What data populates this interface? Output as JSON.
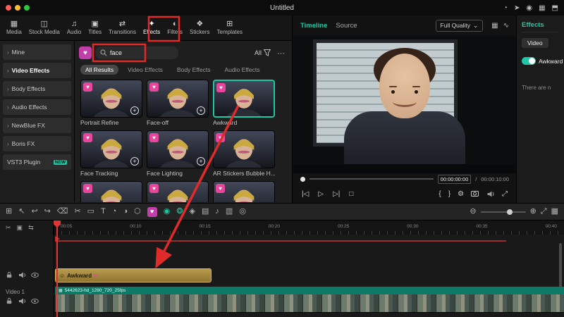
{
  "colors": {
    "accent_teal": "#1ec8a5",
    "accent_pink": "#e8459c",
    "annotation_red": "#e02b2b",
    "clip_gold": "#a98937"
  },
  "titlebar": {
    "title": "Untitled"
  },
  "media_tabs": [
    {
      "label": "Media"
    },
    {
      "label": "Stock Media"
    },
    {
      "label": "Audio"
    },
    {
      "label": "Titles"
    },
    {
      "label": "Transitions"
    },
    {
      "label": "Effects"
    },
    {
      "label": "Filters"
    },
    {
      "label": "Stickers"
    },
    {
      "label": "Templates"
    }
  ],
  "sidebar": {
    "items": [
      {
        "label": "Mine"
      },
      {
        "label": "Video Effects"
      },
      {
        "label": "Body Effects"
      },
      {
        "label": "Audio Effects"
      },
      {
        "label": "NewBlue FX"
      },
      {
        "label": "Boris FX"
      },
      {
        "label": "VST3 Plugin",
        "badge": "NEW"
      }
    ]
  },
  "search": {
    "value": "face",
    "all_label": "All",
    "more_label": "⋯"
  },
  "filter_tabs": [
    {
      "label": "All Results"
    },
    {
      "label": "Video Effects"
    },
    {
      "label": "Body Effects"
    },
    {
      "label": "Audio Effects"
    }
  ],
  "effects_grid": [
    {
      "label": "Portrait Refine"
    },
    {
      "label": "Face-off"
    },
    {
      "label": "Awkward"
    },
    {
      "label": "Face Tracking"
    },
    {
      "label": "Face Lighting"
    },
    {
      "label": "AR Stickers Bubble H..."
    }
  ],
  "preview": {
    "tab_timeline": "Timeline",
    "tab_source": "Source",
    "quality": "Full Quality",
    "timecode_current": "00:00:00:00",
    "timecode_sep": "/",
    "timecode_total": "00:00:10:00"
  },
  "effects_panel": {
    "title": "Effects",
    "video_tab": "Video",
    "effect_name": "Awkward",
    "empty_text": "There are n"
  },
  "timeline": {
    "ruler_marks": [
      "00:05",
      "00:10",
      "00:15",
      "00:20",
      "00:25",
      "00:30",
      "00:35",
      "00:40"
    ],
    "effect_clip_label": "Awkward",
    "video_clip_label": "5442623-hd_1280_720_25fps",
    "video_track_label": "Video 1"
  }
}
